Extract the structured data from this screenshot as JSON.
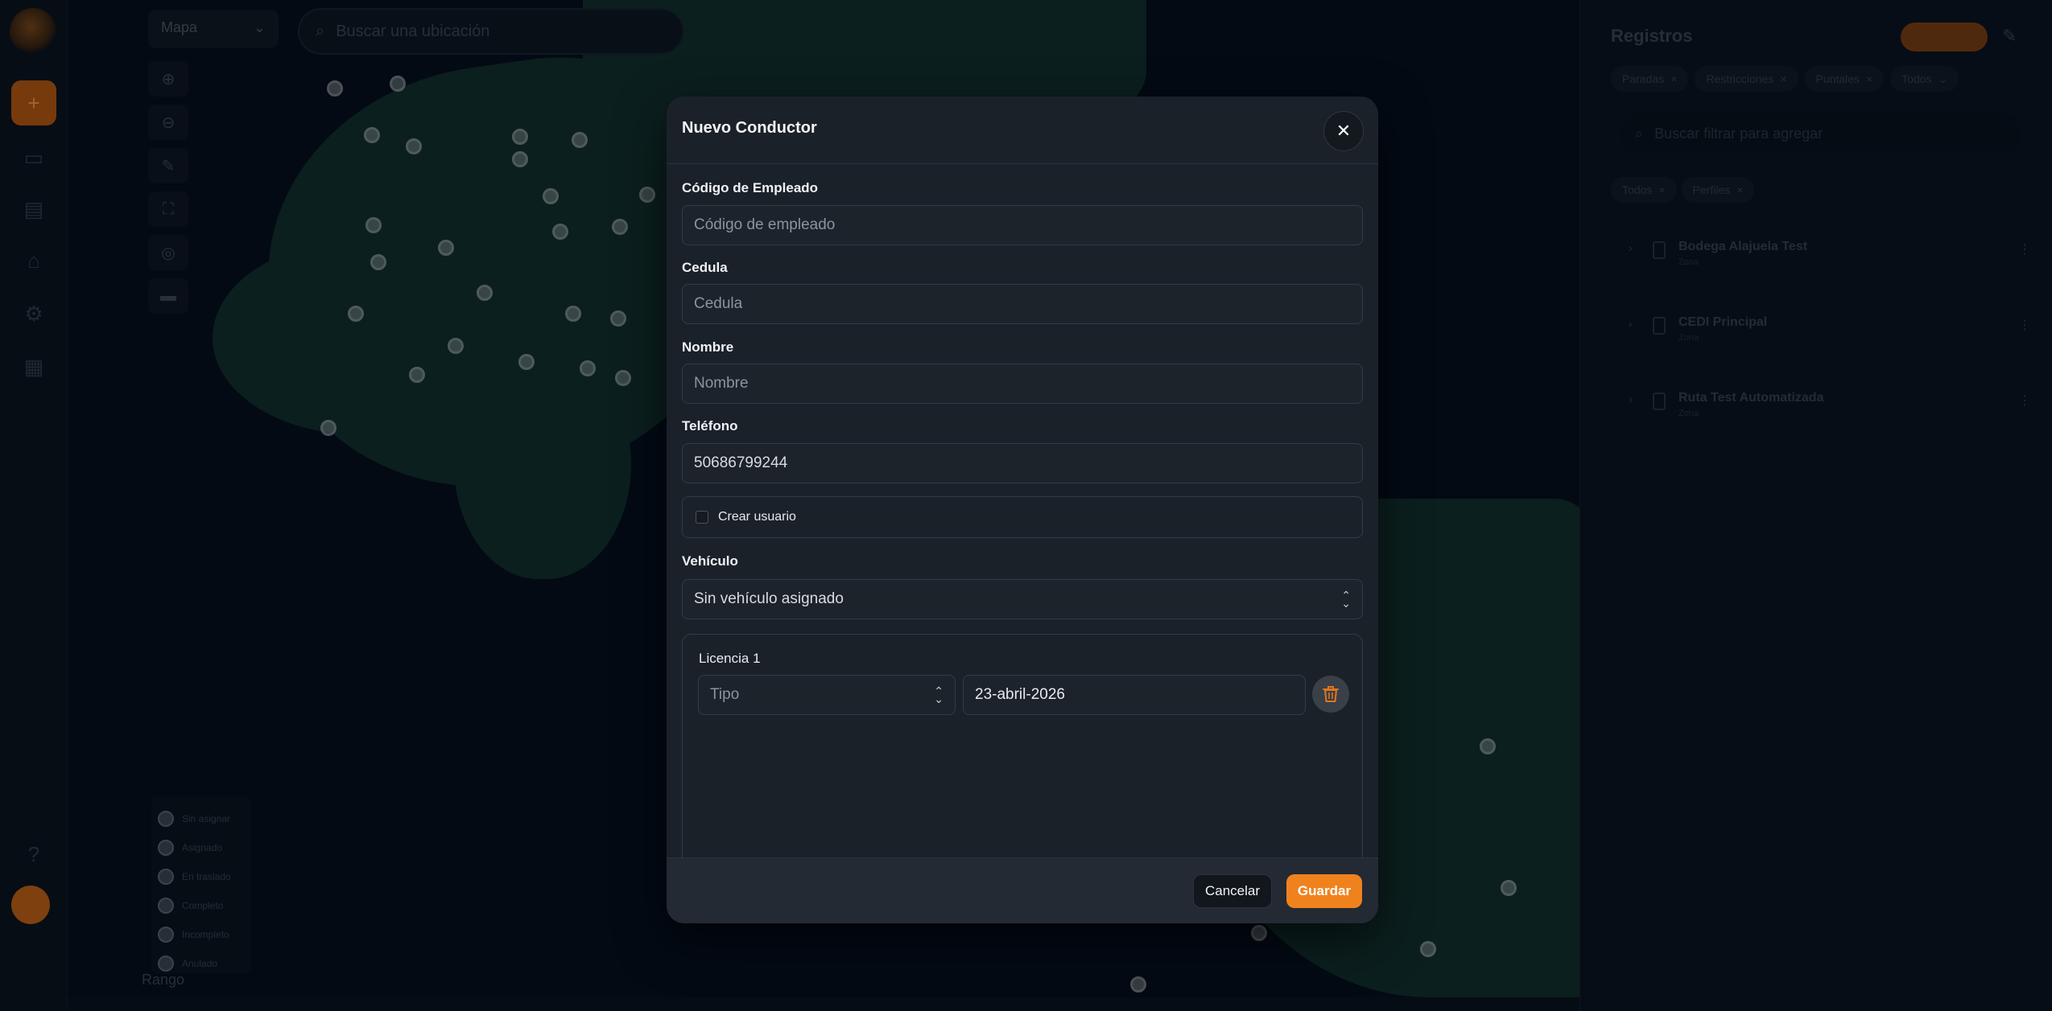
{
  "map": {
    "layer_select": "Mapa",
    "search_placeholder": "Buscar una ubicación",
    "legend": [
      "Sin asignar",
      "Asignado",
      "En traslado",
      "Completo",
      "Incompleto",
      "Anulado"
    ],
    "footer_label": "Rango"
  },
  "right_panel": {
    "title": "Registros",
    "chips": [
      "Paradas",
      "Restricciones",
      "Puntales",
      "Todos"
    ],
    "search_placeholder": "Buscar filtrar para agregar",
    "filters": [
      "Todos",
      "Perfiles"
    ],
    "rows": [
      {
        "title": "Bodega Alajuela Test",
        "sub": "Zona"
      },
      {
        "title": "CEDI Principal",
        "sub": "Zona"
      },
      {
        "title": "Ruta Test Automatizada",
        "sub": "Zona"
      }
    ]
  },
  "modal": {
    "title": "Nuevo Conductor",
    "fields": {
      "employee_code": {
        "label": "Código de Empleado",
        "placeholder": "Código de empleado"
      },
      "cedula": {
        "label": "Cedula",
        "placeholder": "Cedula"
      },
      "nombre": {
        "label": "Nombre",
        "placeholder": "Nombre"
      },
      "telefono": {
        "label": "Teléfono",
        "value": "50686799244"
      }
    },
    "create_user_label": "Crear usuario",
    "vehicle": {
      "label": "Vehículo",
      "value": "Sin vehículo asignado"
    },
    "license": {
      "title": "Licencia 1",
      "type_placeholder": "Tipo",
      "date": "23-abril-2026"
    },
    "cancel_label": "Cancelar",
    "save_label": "Guardar"
  },
  "colors": {
    "accent": "#f0821e",
    "modal_bg": "#1b2129",
    "map_water": "#06101f",
    "map_land": "#12302f"
  }
}
